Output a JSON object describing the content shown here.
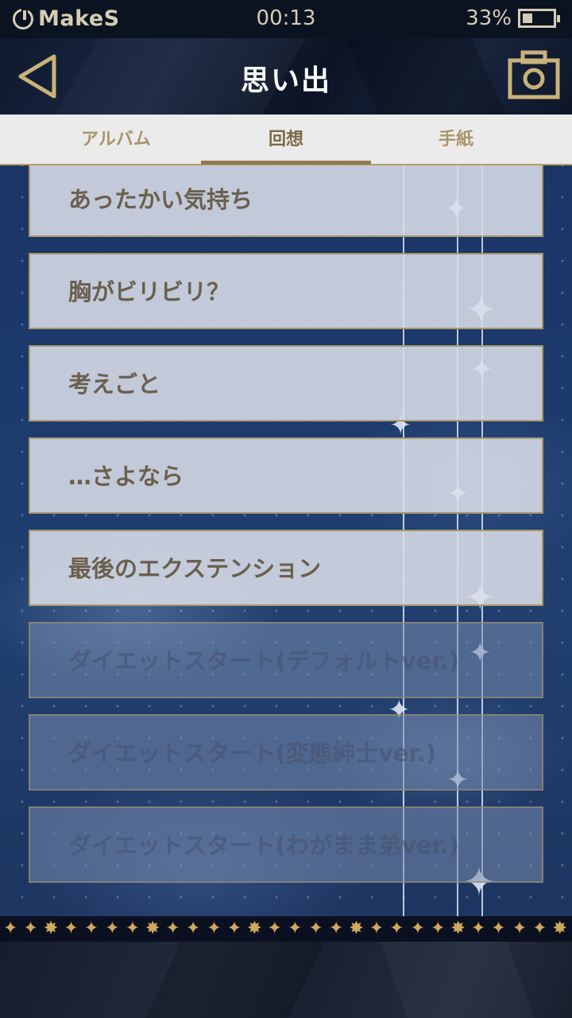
{
  "status_bar": {
    "carrier": "MakeS",
    "time": "00:13",
    "battery_percent": "33%",
    "battery_level": 0.33
  },
  "header": {
    "title": "思い出",
    "back_icon": "back-triangle-icon",
    "camera_icon": "camera-icon"
  },
  "tabs": [
    {
      "label": "アルバム",
      "active": false
    },
    {
      "label": "回想",
      "active": true
    },
    {
      "label": "手紙",
      "active": false
    }
  ],
  "memories": [
    {
      "label": "あったかい気持ち",
      "locked": false
    },
    {
      "label": "胸がビリビリ？",
      "locked": false
    },
    {
      "label": "考えごと",
      "locked": false
    },
    {
      "label": "…さよなら",
      "locked": false
    },
    {
      "label": "最後のエクステンション",
      "locked": false
    },
    {
      "label": "ダイエットスタート(デフォルトver.)",
      "locked": true
    },
    {
      "label": "ダイエットスタート(変態紳士ver.)",
      "locked": true
    },
    {
      "label": "ダイエットスタート(わがまま弟ver.)",
      "locked": true
    }
  ],
  "colors": {
    "accent_gold": "#b59d63",
    "item_text": "#6b5f4e",
    "title_text": "#ffffff"
  }
}
